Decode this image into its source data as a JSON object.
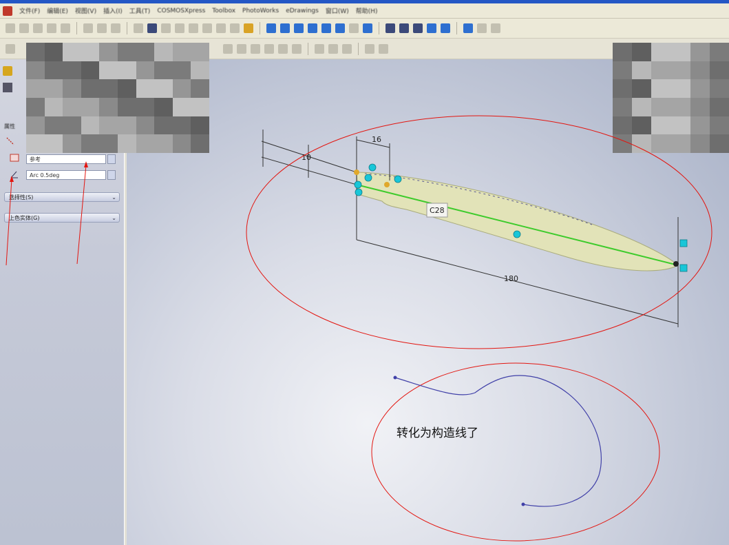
{
  "menu": {
    "items": [
      "文件(F)",
      "编辑(E)",
      "视图(V)",
      "插入(I)",
      "工具(T)",
      "COSMOSXpress",
      "Toolbox",
      "PhotoWorks",
      "eDrawings",
      "窗口(W)",
      "帮助(H)"
    ]
  },
  "left_panel": {
    "group_title": "属性",
    "field_1": "参考",
    "field_2": "Arc 0.5deg",
    "section_1": "选择性(S)",
    "section_2": "上色实体(G)"
  },
  "viewport": {
    "annotation_text": "转化为构造线了",
    "dimensions": {
      "top_small": "16",
      "left_small": "10",
      "overall_length": "180",
      "center_label": "C28"
    }
  },
  "colors": {
    "annotation_red": "#e3150f",
    "sketch_blue": "#4040a8",
    "centerline_green": "#3ecb2c",
    "body_fill": "#e2e3b8",
    "handle_cyan": "#18c6d8"
  }
}
